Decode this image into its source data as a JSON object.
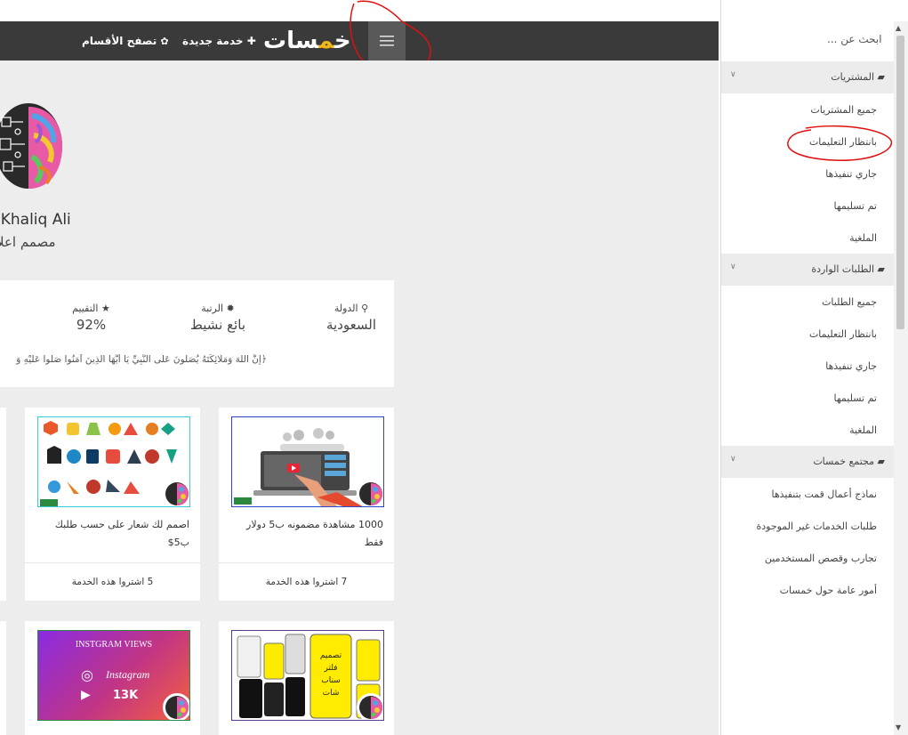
{
  "navbar": {
    "logo_main": "خمسات",
    "new_service": "خدمة جديدة",
    "browse_sections": "تصفح الأقسام"
  },
  "profile": {
    "name": "lKhaliq Ali",
    "subtitle": "مصمم اعلا"
  },
  "stats": [
    {
      "label": "الدولة",
      "value": "السعودية",
      "icon": "map-marker-icon"
    },
    {
      "label": "الرتبة",
      "value": "بائع نشيط",
      "icon": "gear-icon"
    },
    {
      "label": "التقييم",
      "value": "92%",
      "icon": "star-icon"
    }
  ],
  "verse": "﴿إِنَّ اللَّهَ وَمَلَائِكَتَهُ يُصَلُّونَ عَلَى النَّبِيِّ يَا أَيُّهَا الَّذِينَ آمَنُوا صَلُّوا عَلَيْهِ وَ",
  "services": [
    {
      "title": "1000 مشاهدة مضمونه ب5 دولار فقط",
      "buyers": "7 اشتروا هذه الخدمة"
    },
    {
      "title": "اصمم لك شعار على حسب طلبك ب5$",
      "buyers": "5 اشتروا هذه الخدمة"
    },
    {
      "title": "",
      "buyers": ""
    },
    {
      "title": "",
      "buyers": "",
      "thumb_title": "INSTGRAM VIEWS",
      "thumb_brand": "Instagram",
      "thumb_count": "13K"
    }
  ],
  "service_thumb3_text": "تصميم فلتر سناب شات احترافي",
  "sidebar": {
    "search_placeholder": "ابحث عن ...",
    "sections": [
      {
        "title": "المشتريات",
        "icon": "folder-open-icon",
        "items": [
          "جميع المشتريات",
          "بانتظار التعليمات",
          "جاري تنفيذها",
          "تم تسليمها",
          "الملغية"
        ]
      },
      {
        "title": "الطلبات الواردة",
        "icon": "truck-icon",
        "items": [
          "جميع الطلبات",
          "بانتظار التعليمات",
          "جاري تنفيذها",
          "تم تسليمها",
          "الملغية"
        ]
      },
      {
        "title": "مجتمع خمسات",
        "icon": "comments-icon",
        "items": [
          "نماذج أعمال قمت بتنفيذها",
          "طلبات الخدمات غير الموجودة",
          "تجارب وقصص المستخدمين",
          "أمور عامة حول خمسات"
        ]
      }
    ]
  },
  "colors": {
    "navbar_bg": "#3a3a3a",
    "logo_accent": "#f2b51c",
    "annotation_red": "#e01010",
    "thumb_border": "#2b46c7"
  }
}
